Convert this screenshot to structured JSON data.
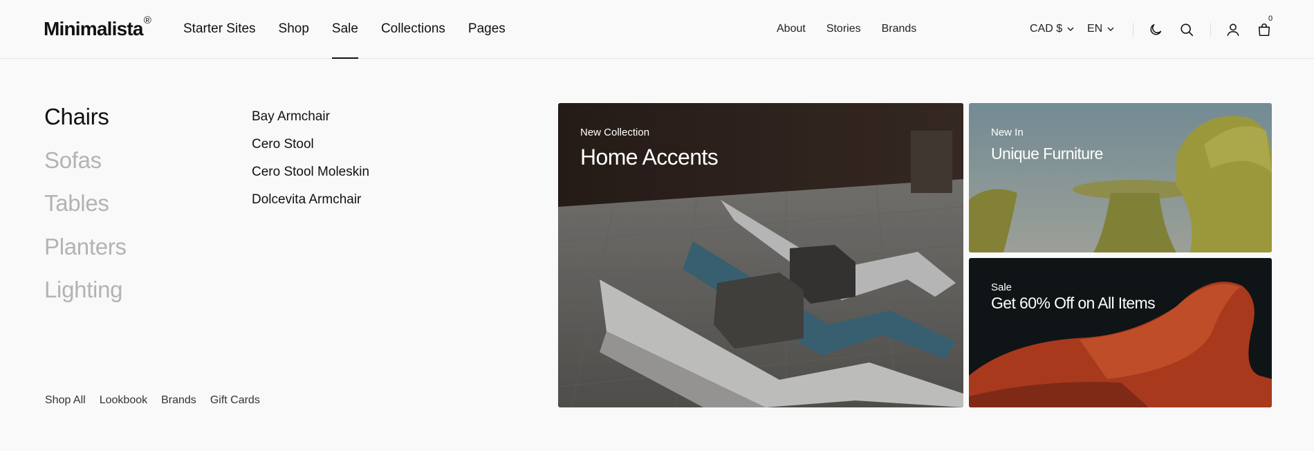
{
  "brand": {
    "name": "Minimalista",
    "mark": "®"
  },
  "nav_main": [
    "Starter Sites",
    "Shop",
    "Sale",
    "Collections",
    "Pages"
  ],
  "nav_active": "Sale",
  "nav_secondary": [
    "About",
    "Stories",
    "Brands"
  ],
  "currency": "CAD $",
  "language": "EN",
  "cart_count": "0",
  "icons": [
    "dark-mode-moon-icon",
    "search-icon",
    "account-icon",
    "cart-bag-icon",
    "chevron-down-icon"
  ],
  "mega_menu": {
    "categories": [
      "Chairs",
      "Sofas",
      "Tables",
      "Planters",
      "Lighting"
    ],
    "active_category": "Chairs",
    "items": [
      "Bay Armchair",
      "Cero Stool",
      "Cero Stool Moleskin",
      "Dolcevita Armchair"
    ],
    "footer_links": [
      "Shop All",
      "Lookbook",
      "Brands",
      "Gift Cards"
    ]
  },
  "promos": [
    {
      "eyebrow": "New Collection",
      "title": "Home Accents"
    },
    {
      "eyebrow": "New In",
      "title": "Unique Furniture"
    },
    {
      "eyebrow": "Sale",
      "title": "Get 60% Off on All Items"
    }
  ],
  "colors": {
    "background": "#f9f9f9",
    "text": "#111111",
    "muted": "#b3b3b3",
    "divider": "#e4e4e4"
  }
}
